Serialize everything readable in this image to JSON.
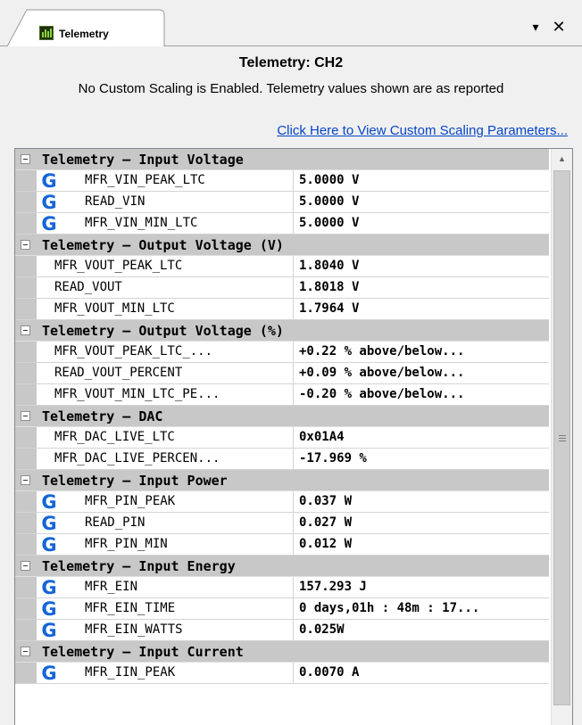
{
  "tab": {
    "label": "Telemetry",
    "menu_glyph": "▾",
    "close_glyph": "✕",
    "icon": "telemetry-icon"
  },
  "header": {
    "title": "Telemetry: CH2",
    "subtitle": "No Custom Scaling is Enabled.  Telemetry values shown are as reported",
    "link": "Click Here to View Custom Scaling Parameters..."
  },
  "groups": [
    {
      "label": "Telemetry — Input Voltage",
      "rows": [
        {
          "name": "MFR_VIN_PEAK_LTC",
          "value": "5.0000 V",
          "icon": true
        },
        {
          "name": "READ_VIN",
          "value": "5.0000 V",
          "icon": true
        },
        {
          "name": "MFR_VIN_MIN_LTC",
          "value": "5.0000 V",
          "icon": true
        }
      ]
    },
    {
      "label": "Telemetry — Output Voltage (V)",
      "rows": [
        {
          "name": "MFR_VOUT_PEAK_LTC",
          "value": "1.8040 V",
          "icon": false
        },
        {
          "name": "READ_VOUT",
          "value": "1.8018 V",
          "icon": false
        },
        {
          "name": "MFR_VOUT_MIN_LTC",
          "value": "1.7964 V",
          "icon": false
        }
      ]
    },
    {
      "label": "Telemetry — Output Voltage (%)",
      "rows": [
        {
          "name": "MFR_VOUT_PEAK_LTC_...",
          "value": "+0.22 % above/below...",
          "icon": false
        },
        {
          "name": "READ_VOUT_PERCENT",
          "value": "+0.09 % above/below...",
          "icon": false
        },
        {
          "name": "MFR_VOUT_MIN_LTC_PE...",
          "value": "-0.20 % above/below...",
          "icon": false
        }
      ]
    },
    {
      "label": "Telemetry — DAC",
      "rows": [
        {
          "name": "MFR_DAC_LIVE_LTC",
          "value": "0x01A4",
          "icon": false
        },
        {
          "name": "MFR_DAC_LIVE_PERCEN...",
          "value": "-17.969 %",
          "icon": false
        }
      ]
    },
    {
      "label": "Telemetry — Input Power",
      "rows": [
        {
          "name": "MFR_PIN_PEAK",
          "value": "0.037 W",
          "icon": true
        },
        {
          "name": "READ_PIN",
          "value": "0.027 W",
          "icon": true
        },
        {
          "name": "MFR_PIN_MIN",
          "value": "0.012 W",
          "icon": true
        }
      ]
    },
    {
      "label": "Telemetry — Input Energy",
      "rows": [
        {
          "name": "MFR_EIN",
          "value": "157.293  J",
          "icon": true
        },
        {
          "name": "MFR_EIN_TIME",
          "value": "0 days,01h : 48m : 17...",
          "icon": true
        },
        {
          "name": "MFR_EIN_WATTS",
          "value": "0.025W",
          "icon": true
        }
      ]
    },
    {
      "label": "Telemetry — Input Current",
      "rows": [
        {
          "name": "MFR_IIN_PEAK",
          "value": "0.0070 A",
          "icon": true
        }
      ]
    }
  ],
  "icons": {
    "group_toggle": "collapse-minus-icon",
    "row_icon": "g-logo-icon",
    "g_glyph": "G",
    "scroll_up": "▲"
  },
  "colors": {
    "link": "#0645c8",
    "group_bg": "#c8c8c8",
    "icon_blue": "#1565d8"
  }
}
